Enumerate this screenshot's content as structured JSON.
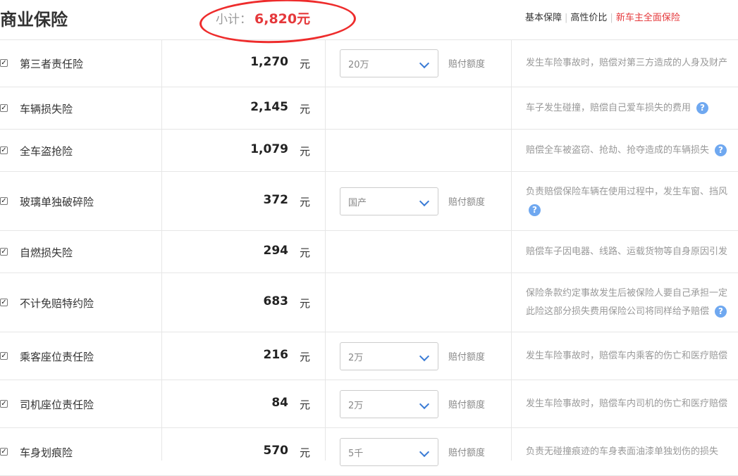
{
  "header": {
    "title": "商业保险",
    "subtotal_label": "小计：",
    "subtotal_value": "6,820元",
    "tabs": [
      {
        "label": "基本保障"
      },
      {
        "label": "高性价比"
      },
      {
        "label": "新车主全面保险"
      }
    ],
    "active_tab": "新车主全面保险",
    "annotation_color": "#ee2c2c"
  },
  "select_suffix": "赔付额度",
  "unit": "元",
  "rows": [
    {
      "name": "第三者责任险",
      "checked": true,
      "price": "1,270",
      "select": "20万",
      "desc": [
        "发生车险事故时，赔偿对第三方造成的人身及财产"
      ],
      "help": false
    },
    {
      "name": "车辆损失险",
      "checked": true,
      "price": "2,145",
      "select": null,
      "desc": [
        "车子发生碰撞，赔偿自己爱车损失的费用"
      ],
      "help": true
    },
    {
      "name": "全车盗抢险",
      "checked": true,
      "price": "1,079",
      "select": null,
      "desc": [
        "赔偿全车被盗窃、抢劫、抢夺造成的车辆损失"
      ],
      "help": true
    },
    {
      "name": "玻璃单独破碎险",
      "checked": true,
      "price": "372",
      "select": "国产",
      "desc": [
        "负责赔偿保险车辆在使用过程中，发生车窗、挡风"
      ],
      "help": true
    },
    {
      "name": "自燃损失险",
      "checked": true,
      "price": "294",
      "select": null,
      "desc": [
        "赔偿车子因电器、线路、运载货物等自身原因引发"
      ],
      "help": false
    },
    {
      "name": "不计免赔特约险",
      "checked": true,
      "price": "683",
      "select": null,
      "desc": [
        "保险条款约定事故发生后被保险人要自己承担一定",
        "此险这部分损失费用保险公司将同样给予赔偿"
      ],
      "help": true
    },
    {
      "name": "乘客座位责任险",
      "checked": true,
      "price": "216",
      "select": "2万",
      "desc": [
        "发生车险事故时，赔偿车内乘客的伤亡和医疗赔偿"
      ],
      "help": false
    },
    {
      "name": "司机座位责任险",
      "checked": true,
      "price": "84",
      "select": "2万",
      "desc": [
        "发生车险事故时，赔偿车内司机的伤亡和医疗赔偿"
      ],
      "help": false
    },
    {
      "name": "车身划痕险",
      "checked": true,
      "price": "570",
      "select": "5千",
      "desc": [
        "负责无碰撞痕迹的车身表面油漆单独划伤的损失"
      ],
      "help": false
    }
  ]
}
